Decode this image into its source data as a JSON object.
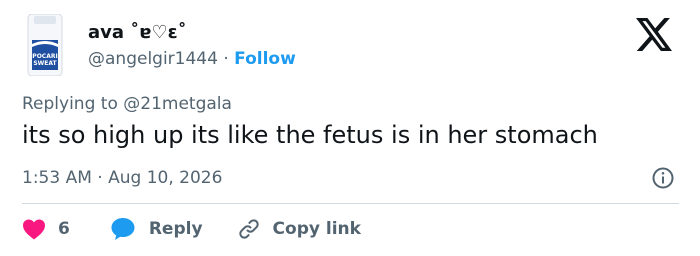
{
  "author": {
    "display_name": "ava ˚ɐ♡ɛ˚",
    "handle": "@angelgir1444",
    "separator": "·",
    "follow_label": "Follow"
  },
  "avatar": {
    "icon": "pocari-sweat-can-avatar",
    "text_lines": [
      "POCARI",
      "SWEAT"
    ]
  },
  "brand_icon": "x-logo-icon",
  "reply_context": {
    "prefix": "Replying to",
    "mention": "@21metgala"
  },
  "tweet": {
    "text": "its so high up its like the fetus is in her stomach"
  },
  "meta": {
    "time": "1:53 AM",
    "separator": "·",
    "date": "Aug 10, 2026"
  },
  "actions": {
    "like_count": "6",
    "reply_label": "Reply",
    "copy_link_label": "Copy link"
  },
  "colors": {
    "text": "#0f1419",
    "secondary": "#536471",
    "accent": "#1d9bf0",
    "like": "#f91880",
    "reply_bubble": "#1d9bf0",
    "divider": "#cfd9de"
  }
}
